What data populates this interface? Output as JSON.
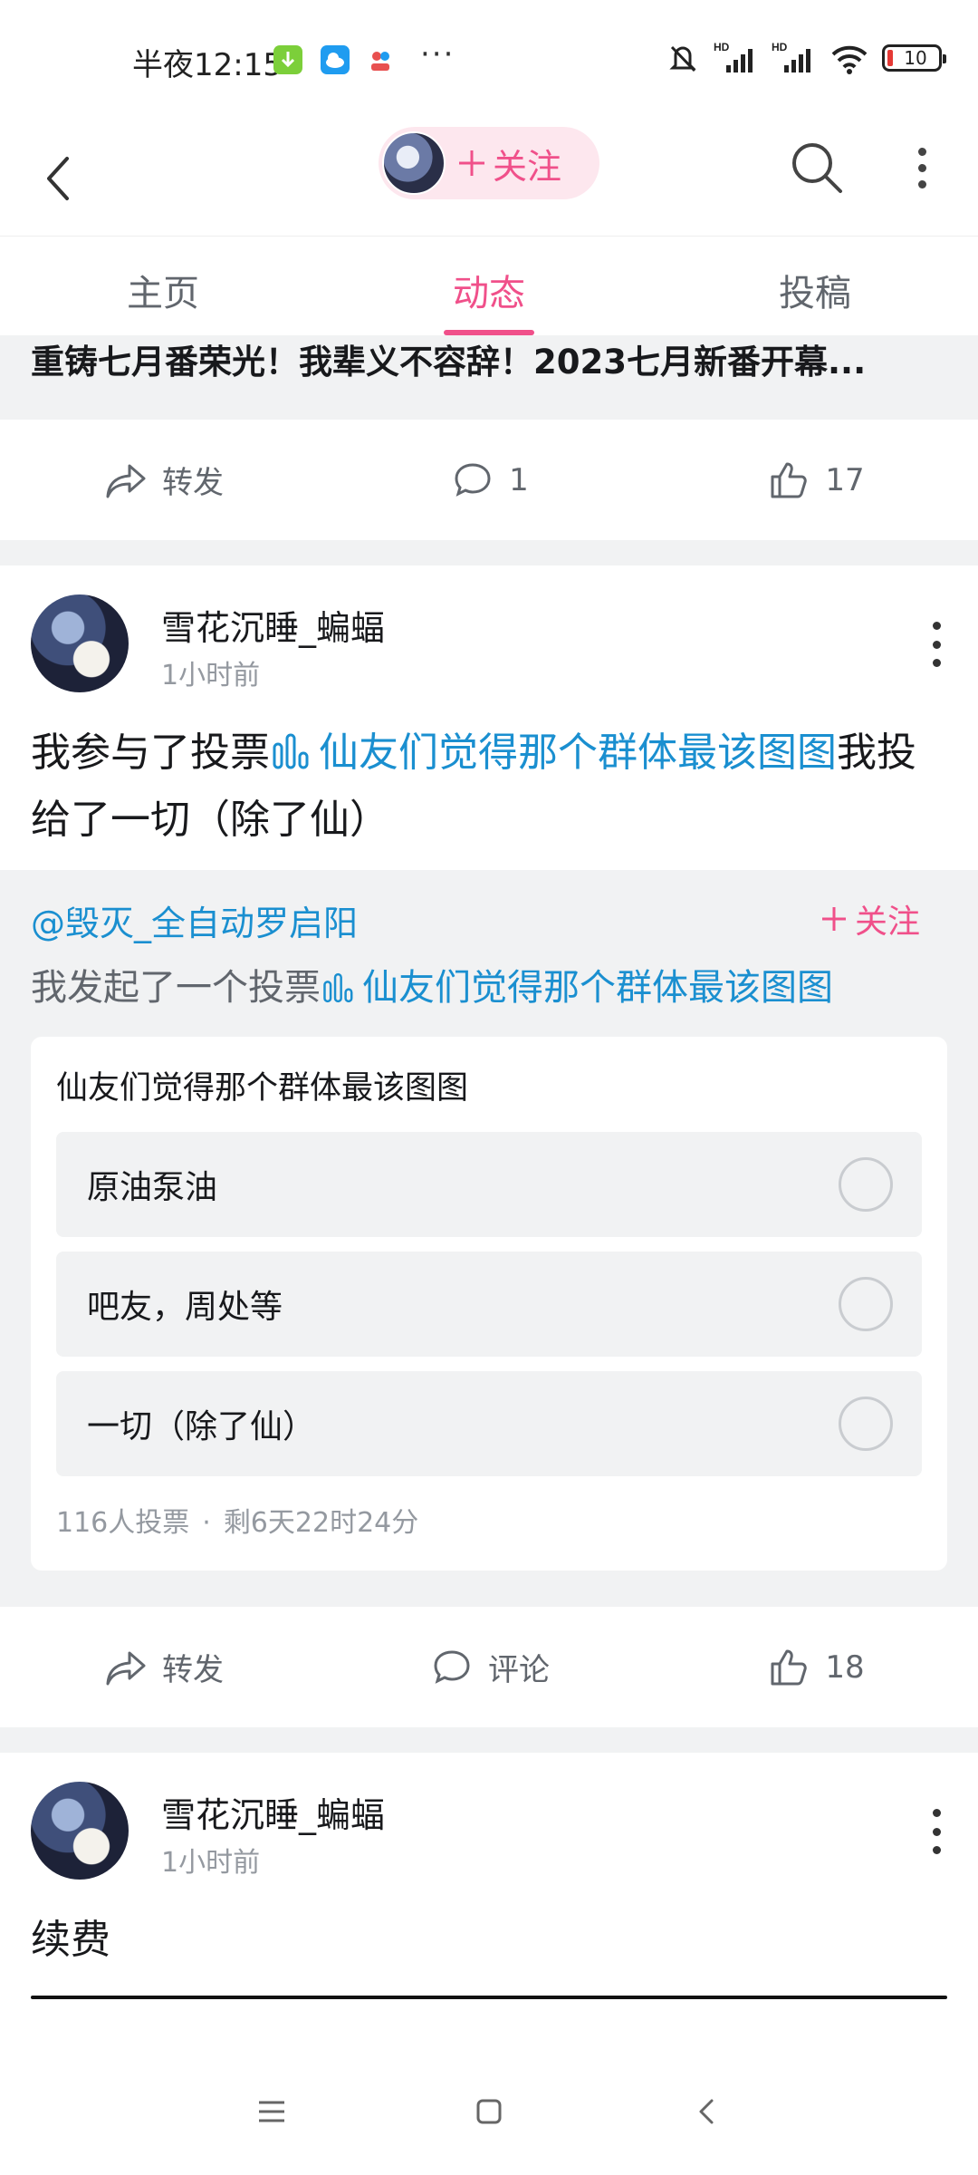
{
  "status_bar": {
    "time": "半夜12:15",
    "more": "···",
    "battery": "10",
    "hd1": "HD",
    "hd2": "HD",
    "app_colors": [
      "#7ccf3a",
      "#1f9cf0",
      "#e85050"
    ]
  },
  "header": {
    "follow_label": "关注",
    "follow_icon": "plus-icon",
    "accent": "#f0508a"
  },
  "tabs": [
    {
      "label": "主页",
      "active": false
    },
    {
      "label": "动态",
      "active": true
    },
    {
      "label": "投稿",
      "active": false
    }
  ],
  "previous_post": {
    "title": "重铸七月番荣光！我辈义不容辞！2023七月新番开幕...",
    "repost_label": "转发",
    "comment_count": "1",
    "like_count": "17"
  },
  "post1": {
    "author": "雪花沉睡_蝙蝠",
    "time": "1小时前",
    "text_before": "我参与了投票",
    "vote_link": "仙友们觉得那个群体最该图图",
    "text_after": "我投给了一切（除了仙）",
    "repost": {
      "user": "@毁灭_全自动罗启阳",
      "follow_label": "关注",
      "text_before": "我发起了一个投票",
      "vote_link": "仙友们觉得那个群体最该图图"
    },
    "vote": {
      "title": "仙友们觉得那个群体最该图图",
      "options": [
        "原油泵油",
        "吧友，周处等",
        "一切（除了仙）"
      ],
      "participants": "116人投票",
      "dot": "·",
      "remaining": "剩6天22时24分"
    },
    "actions": {
      "repost_label": "转发",
      "comment_label": "评论",
      "like_count": "18"
    }
  },
  "post2": {
    "author": "雪花沉睡_蝙蝠",
    "time": "1小时前",
    "text": "续费"
  },
  "link_color": "#1a8fd0"
}
